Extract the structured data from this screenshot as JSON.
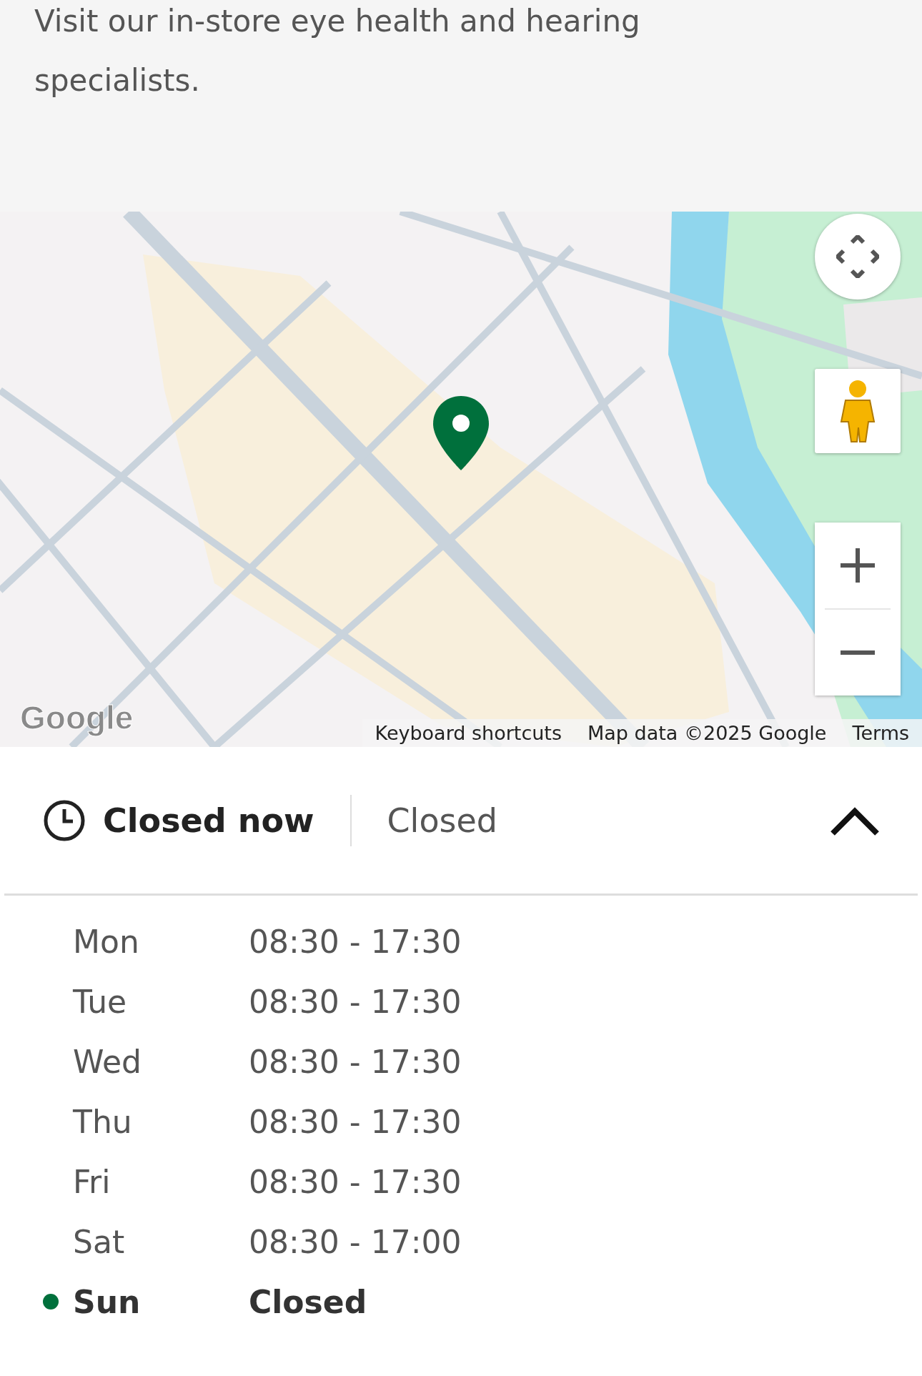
{
  "intro": "Visit our in-store eye health and hearing specialists.",
  "map": {
    "kind": "picture",
    "logo": "Google",
    "attribution": [
      "Keyboard shortcuts",
      "Map data ©2025 Google",
      "Terms"
    ]
  },
  "hours": {
    "status": "Closed now",
    "today": "Closed",
    "expanded": true,
    "days": [
      {
        "day": "Mon",
        "time": "08:30 - 17:30",
        "selected": false
      },
      {
        "day": "Tue",
        "time": "08:30 - 17:30",
        "selected": false
      },
      {
        "day": "Wed",
        "time": "08:30 - 17:30",
        "selected": false
      },
      {
        "day": "Thu",
        "time": "08:30 - 17:30",
        "selected": false
      },
      {
        "day": "Fri",
        "time": "08:30 - 17:30",
        "selected": false
      },
      {
        "day": "Sat",
        "time": "08:30 - 17:00",
        "selected": false
      },
      {
        "day": "Sun",
        "time": "Closed",
        "selected": true
      }
    ]
  }
}
